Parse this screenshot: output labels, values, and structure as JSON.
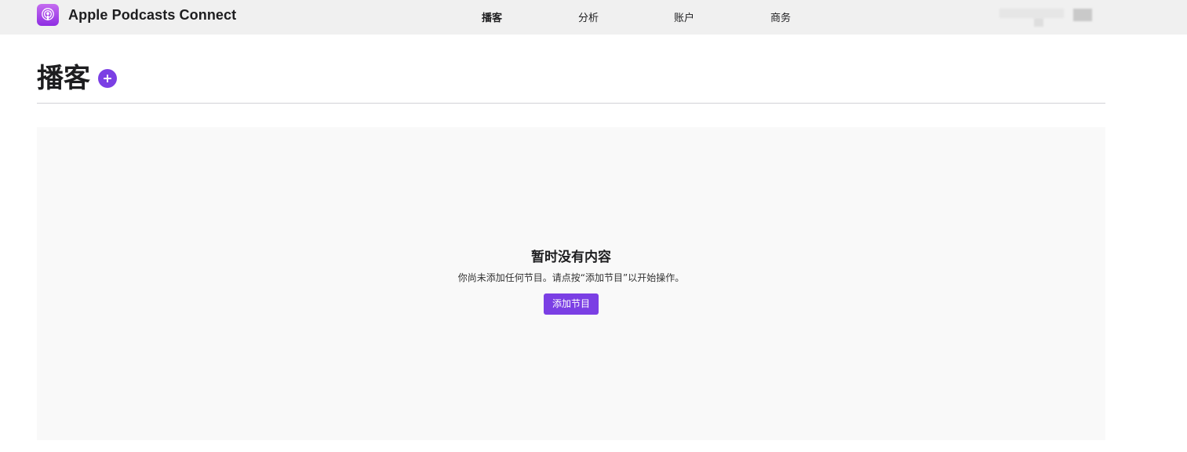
{
  "header": {
    "app_name": "Apple Podcasts Connect",
    "app_icon": "podcasts-icon",
    "nav": [
      {
        "label": "播客",
        "active": true
      },
      {
        "label": "分析",
        "active": false
      },
      {
        "label": "账户",
        "active": false
      },
      {
        "label": "商务",
        "active": false
      }
    ]
  },
  "page": {
    "title": "播客",
    "add_icon": "plus-circle-icon"
  },
  "empty_state": {
    "title": "暂时没有内容",
    "description": "你尚未添加任何节目。请点按“添加节目”以开始操作。",
    "button_label": "添加节目"
  },
  "colors": {
    "accent": "#7b3fe4",
    "header_bg": "#f0f0f0",
    "panel_bg": "#f9f9f9",
    "divider": "#d2d2d7"
  }
}
